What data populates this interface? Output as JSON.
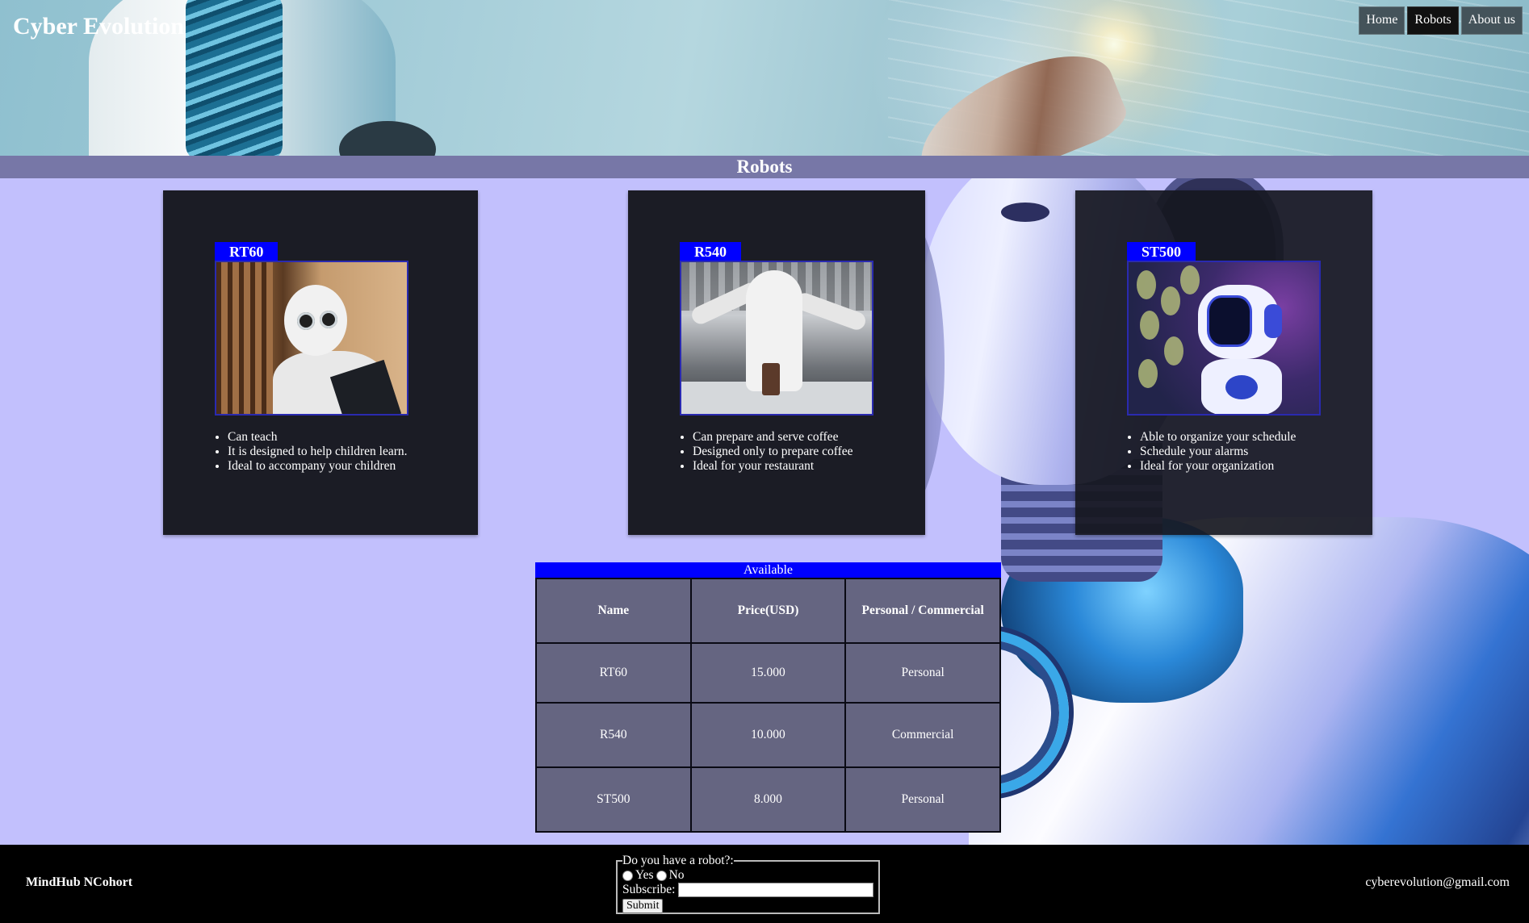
{
  "header": {
    "title": "Cyber Evolution",
    "nav": [
      {
        "label": "Home",
        "active": false
      },
      {
        "label": "Robots",
        "active": true
      },
      {
        "label": "About us",
        "active": false
      }
    ]
  },
  "section": {
    "title": "Robots"
  },
  "cards": [
    {
      "name": "RT60",
      "features": [
        "Can teach",
        "It is designed to help children learn.",
        "Ideal to accompany your children"
      ]
    },
    {
      "name": "R540",
      "features": [
        "Can prepare and serve coffee",
        "Designed only to prepare coffee",
        "Ideal for your restaurant"
      ]
    },
    {
      "name": "ST500",
      "features": [
        "Able to organize your schedule",
        "Schedule your alarms",
        "Ideal for your organization"
      ]
    }
  ],
  "table": {
    "caption": "Available",
    "headers": [
      "Name",
      "Price(USD)",
      "Personal / Commercial"
    ],
    "rows": [
      [
        "RT60",
        "15.000",
        "Personal"
      ],
      [
        "R540",
        "10.000",
        "Commercial"
      ],
      [
        "ST500",
        "8.000",
        "Personal"
      ]
    ]
  },
  "footer": {
    "brand": "MindHub NCohort",
    "email": "cyberevolution@gmail.com",
    "survey": {
      "legend": "Do you have a robot?:",
      "yes_label": "Yes",
      "no_label": "No",
      "subscribe_label": "Subscribe:",
      "subscribe_value": "",
      "submit_label": "Submit"
    }
  },
  "colors": {
    "accent": "#0000ff",
    "page_bg": "#c2c0fd",
    "band": "#7777a7",
    "card_bg": "#1b1c25",
    "table_cell": "#656581",
    "footer_bg": "#000000"
  }
}
